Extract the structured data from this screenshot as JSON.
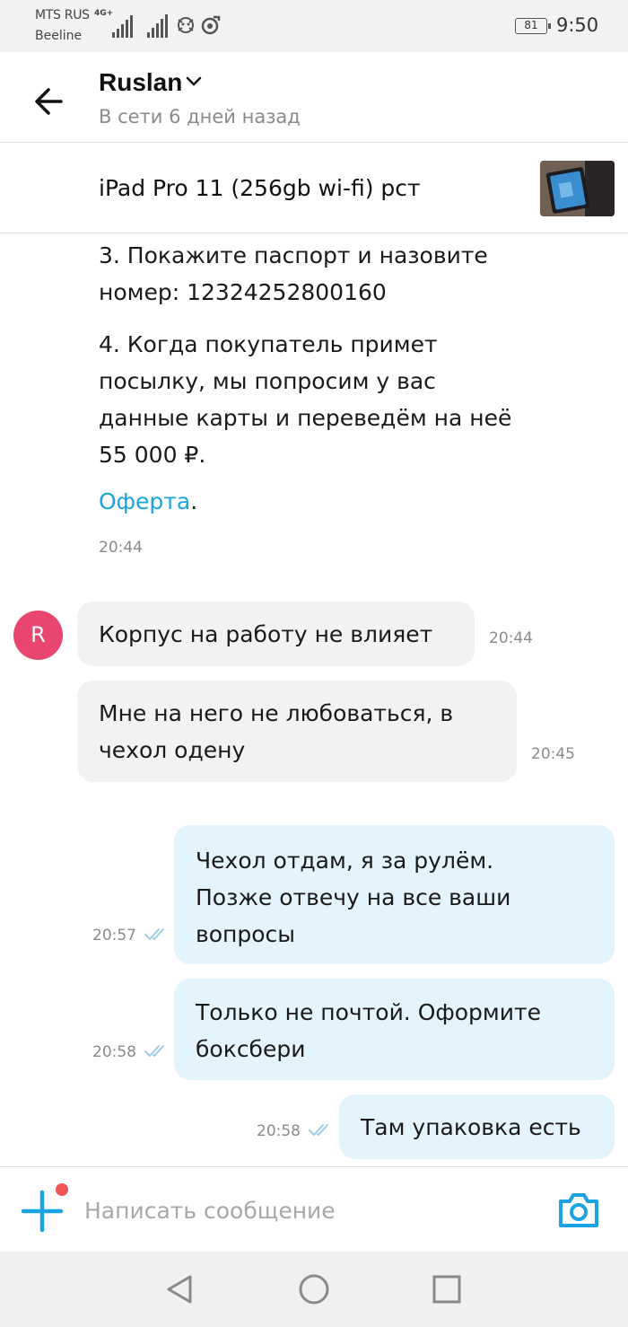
{
  "status_bar": {
    "carrier_primary": "MTS RUS",
    "carrier_secondary": "Beeline",
    "network_type": "4G+",
    "battery": "81",
    "time": "9:50"
  },
  "header": {
    "name": "Ruslan",
    "status": "В сети 6 дней назад"
  },
  "listing": {
    "title": "iPad Pro 11 (256gb wi-fi) рст"
  },
  "system_message": {
    "step3": "3. Покажите паспорт и назовите номер: 12324252800160",
    "step4": "4. Когда покупатель примет посылку, мы попросим у вас данные карты и переведём на неё 55 000 ₽.",
    "link_label": "Оферта",
    "link_suffix": ".",
    "time": "20:44"
  },
  "avatar_letter": "R",
  "messages": [
    {
      "direction": "incoming",
      "text": "Корпус на работу не влияет",
      "time": "20:44"
    },
    {
      "direction": "incoming",
      "text": "Мне на него не любоваться, в чехол одену",
      "time": "20:45"
    },
    {
      "direction": "outgoing",
      "text": "Чехол отдам, я за рулём. Позже отвечу на все ваши вопросы",
      "time": "20:57",
      "read": true
    },
    {
      "direction": "outgoing",
      "text": "Только не почтой. Оформите боксбери",
      "time": "20:58",
      "read": true
    },
    {
      "direction": "outgoing",
      "text": "Там упаковка есть",
      "time": "20:58",
      "read": true
    }
  ],
  "composer": {
    "placeholder": "Написать сообщение"
  },
  "colors": {
    "accent": "#1aa3e0",
    "avatar": "#e8466f",
    "incoming_bubble": "#f2f2f2",
    "outgoing_bubble": "#e3f4fc",
    "notification_dot": "#f25555"
  },
  "icons": {
    "back": "arrow-left-icon",
    "chevron": "chevron-down-icon",
    "attach": "plus-icon",
    "camera": "camera-icon",
    "read": "double-check-icon"
  }
}
